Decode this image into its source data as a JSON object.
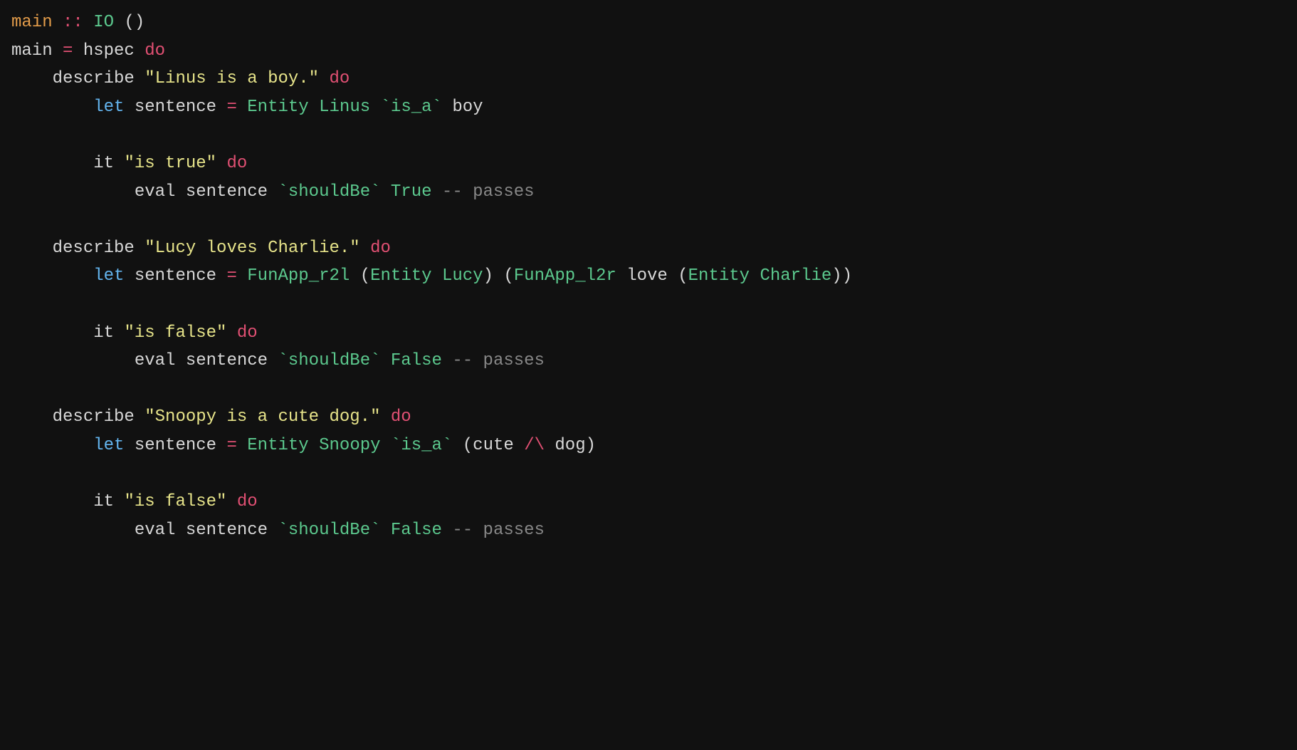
{
  "code_lines": [
    [
      {
        "cls": "tok-fn",
        "t": "main"
      },
      {
        "cls": "tok-id",
        "t": " "
      },
      {
        "cls": "tok-op",
        "t": "::"
      },
      {
        "cls": "tok-id",
        "t": " "
      },
      {
        "cls": "tok-type",
        "t": "IO"
      },
      {
        "cls": "tok-id",
        "t": " "
      },
      {
        "cls": "tok-par",
        "t": "()"
      }
    ],
    [
      {
        "cls": "tok-id",
        "t": "main "
      },
      {
        "cls": "tok-op",
        "t": "="
      },
      {
        "cls": "tok-id",
        "t": " hspec "
      },
      {
        "cls": "tok-kw",
        "t": "do"
      }
    ],
    [
      {
        "cls": "tok-id",
        "t": "    describe "
      },
      {
        "cls": "tok-str",
        "t": "\"Linus is a boy.\""
      },
      {
        "cls": "tok-id",
        "t": " "
      },
      {
        "cls": "tok-kw",
        "t": "do"
      }
    ],
    [
      {
        "cls": "tok-id",
        "t": "        "
      },
      {
        "cls": "tok-sp",
        "t": "let"
      },
      {
        "cls": "tok-id",
        "t": " sentence "
      },
      {
        "cls": "tok-op",
        "t": "="
      },
      {
        "cls": "tok-id",
        "t": " "
      },
      {
        "cls": "tok-type",
        "t": "Entity"
      },
      {
        "cls": "tok-id",
        "t": " "
      },
      {
        "cls": "tok-type",
        "t": "Linus"
      },
      {
        "cls": "tok-id",
        "t": " "
      },
      {
        "cls": "tok-bt",
        "t": "`is_a`"
      },
      {
        "cls": "tok-id",
        "t": " boy"
      }
    ],
    [
      {
        "cls": "tok-id",
        "t": ""
      }
    ],
    [
      {
        "cls": "tok-id",
        "t": "        it "
      },
      {
        "cls": "tok-str",
        "t": "\"is true\""
      },
      {
        "cls": "tok-id",
        "t": " "
      },
      {
        "cls": "tok-kw",
        "t": "do"
      }
    ],
    [
      {
        "cls": "tok-id",
        "t": "            eval sentence "
      },
      {
        "cls": "tok-bt",
        "t": "`shouldBe`"
      },
      {
        "cls": "tok-id",
        "t": " "
      },
      {
        "cls": "tok-type",
        "t": "True"
      },
      {
        "cls": "tok-id",
        "t": " "
      },
      {
        "cls": "tok-cmt",
        "t": "-- passes"
      }
    ],
    [
      {
        "cls": "tok-id",
        "t": ""
      }
    ],
    [
      {
        "cls": "tok-id",
        "t": "    describe "
      },
      {
        "cls": "tok-str",
        "t": "\"Lucy loves Charlie.\""
      },
      {
        "cls": "tok-id",
        "t": " "
      },
      {
        "cls": "tok-kw",
        "t": "do"
      }
    ],
    [
      {
        "cls": "tok-id",
        "t": "        "
      },
      {
        "cls": "tok-sp",
        "t": "let"
      },
      {
        "cls": "tok-id",
        "t": " sentence "
      },
      {
        "cls": "tok-op",
        "t": "="
      },
      {
        "cls": "tok-id",
        "t": " "
      },
      {
        "cls": "tok-type",
        "t": "FunApp_r2l"
      },
      {
        "cls": "tok-id",
        "t": " "
      },
      {
        "cls": "tok-par",
        "t": "("
      },
      {
        "cls": "tok-type",
        "t": "Entity"
      },
      {
        "cls": "tok-id",
        "t": " "
      },
      {
        "cls": "tok-type",
        "t": "Lucy"
      },
      {
        "cls": "tok-par",
        "t": ")"
      },
      {
        "cls": "tok-id",
        "t": " "
      },
      {
        "cls": "tok-par",
        "t": "("
      },
      {
        "cls": "tok-type",
        "t": "FunApp_l2r"
      },
      {
        "cls": "tok-id",
        "t": " love "
      },
      {
        "cls": "tok-par",
        "t": "("
      },
      {
        "cls": "tok-type",
        "t": "Entity"
      },
      {
        "cls": "tok-id",
        "t": " "
      },
      {
        "cls": "tok-type",
        "t": "Charlie"
      },
      {
        "cls": "tok-par",
        "t": "))"
      }
    ],
    [
      {
        "cls": "tok-id",
        "t": ""
      }
    ],
    [
      {
        "cls": "tok-id",
        "t": "        it "
      },
      {
        "cls": "tok-str",
        "t": "\"is false\""
      },
      {
        "cls": "tok-id",
        "t": " "
      },
      {
        "cls": "tok-kw",
        "t": "do"
      }
    ],
    [
      {
        "cls": "tok-id",
        "t": "            eval sentence "
      },
      {
        "cls": "tok-bt",
        "t": "`shouldBe`"
      },
      {
        "cls": "tok-id",
        "t": " "
      },
      {
        "cls": "tok-type",
        "t": "False"
      },
      {
        "cls": "tok-id",
        "t": " "
      },
      {
        "cls": "tok-cmt",
        "t": "-- passes"
      }
    ],
    [
      {
        "cls": "tok-id",
        "t": ""
      }
    ],
    [
      {
        "cls": "tok-id",
        "t": "    describe "
      },
      {
        "cls": "tok-str",
        "t": "\"Snoopy is a cute dog.\""
      },
      {
        "cls": "tok-id",
        "t": " "
      },
      {
        "cls": "tok-kw",
        "t": "do"
      }
    ],
    [
      {
        "cls": "tok-id",
        "t": "        "
      },
      {
        "cls": "tok-sp",
        "t": "let"
      },
      {
        "cls": "tok-id",
        "t": " sentence "
      },
      {
        "cls": "tok-op",
        "t": "="
      },
      {
        "cls": "tok-id",
        "t": " "
      },
      {
        "cls": "tok-type",
        "t": "Entity"
      },
      {
        "cls": "tok-id",
        "t": " "
      },
      {
        "cls": "tok-type",
        "t": "Snoopy"
      },
      {
        "cls": "tok-id",
        "t": " "
      },
      {
        "cls": "tok-bt",
        "t": "`is_a`"
      },
      {
        "cls": "tok-id",
        "t": " "
      },
      {
        "cls": "tok-par",
        "t": "("
      },
      {
        "cls": "tok-id",
        "t": "cute "
      },
      {
        "cls": "tok-op",
        "t": "/\\"
      },
      {
        "cls": "tok-id",
        "t": " dog"
      },
      {
        "cls": "tok-par",
        "t": ")"
      }
    ],
    [
      {
        "cls": "tok-id",
        "t": ""
      }
    ],
    [
      {
        "cls": "tok-id",
        "t": "        it "
      },
      {
        "cls": "tok-str",
        "t": "\"is false\""
      },
      {
        "cls": "tok-id",
        "t": " "
      },
      {
        "cls": "tok-kw",
        "t": "do"
      }
    ],
    [
      {
        "cls": "tok-id",
        "t": "            eval sentence "
      },
      {
        "cls": "tok-bt",
        "t": "`shouldBe`"
      },
      {
        "cls": "tok-id",
        "t": " "
      },
      {
        "cls": "tok-type",
        "t": "False"
      },
      {
        "cls": "tok-id",
        "t": " "
      },
      {
        "cls": "tok-cmt",
        "t": "-- passes"
      }
    ]
  ]
}
